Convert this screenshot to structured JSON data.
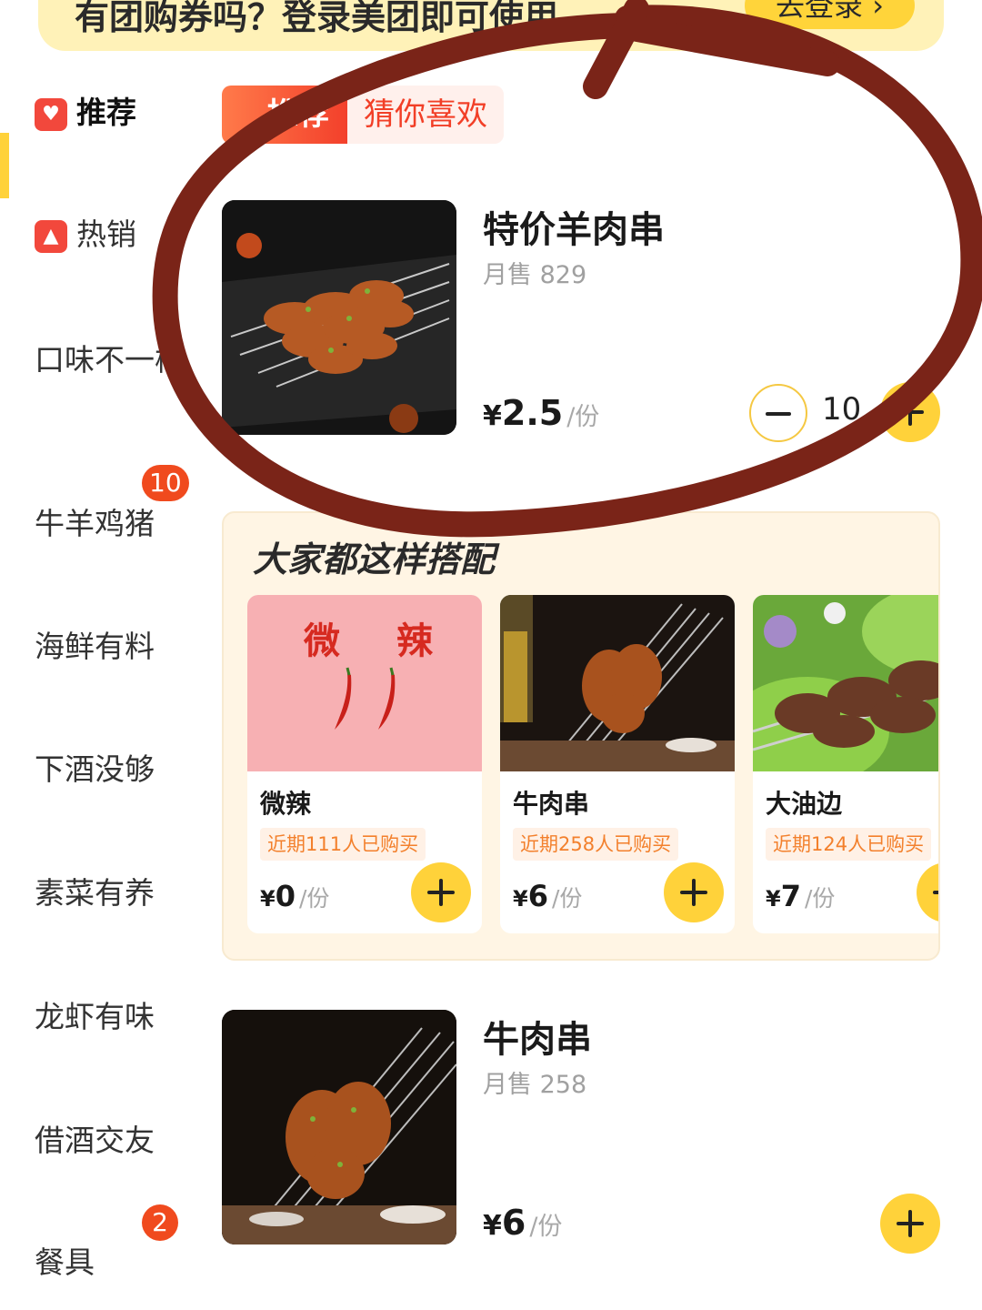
{
  "banner": {
    "text": "有团购券吗？登录美团即可使用",
    "login_label": "去登录 ›"
  },
  "sidebar": {
    "items": [
      {
        "label": "推荐",
        "icon": "heart-icon"
      },
      {
        "label": "热销",
        "icon": "flame-icon"
      },
      {
        "label": "口味不一样"
      },
      {
        "label": "牛羊鸡猪",
        "badge": "10"
      },
      {
        "label": "海鲜有料"
      },
      {
        "label": "下酒没够"
      },
      {
        "label": "素菜有养"
      },
      {
        "label": "龙虾有味"
      },
      {
        "label": "借酒交友"
      },
      {
        "label": "餐具",
        "badge": "2"
      }
    ]
  },
  "rec_tabs": {
    "primary": "推荐",
    "secondary": "猜你喜欢"
  },
  "featured": {
    "name": "特价羊肉串",
    "sales": "月售 829",
    "currency": "¥",
    "price": "2.5",
    "unit": "/份",
    "quantity": "10"
  },
  "combo": {
    "title": "大家都这样搭配",
    "cards": [
      {
        "name": "微辣",
        "image_text_1": "微",
        "image_text_2": "辣",
        "tag": "近期111人已购买",
        "currency": "¥",
        "price": "0",
        "unit": "/份"
      },
      {
        "name": "牛肉串",
        "tag": "近期258人已购买",
        "currency": "¥",
        "price": "6",
        "unit": "/份"
      },
      {
        "name": "大油边",
        "tag": "近期124人已购买",
        "currency": "¥",
        "price": "7",
        "unit": "/份"
      }
    ]
  },
  "product2": {
    "name": "牛肉串",
    "sales": "月售 258",
    "currency": "¥",
    "price": "6",
    "unit": "/份"
  },
  "colors": {
    "accent_yellow": "#ffd23a",
    "accent_red": "#f3402b",
    "annotation": "#7a2418"
  }
}
